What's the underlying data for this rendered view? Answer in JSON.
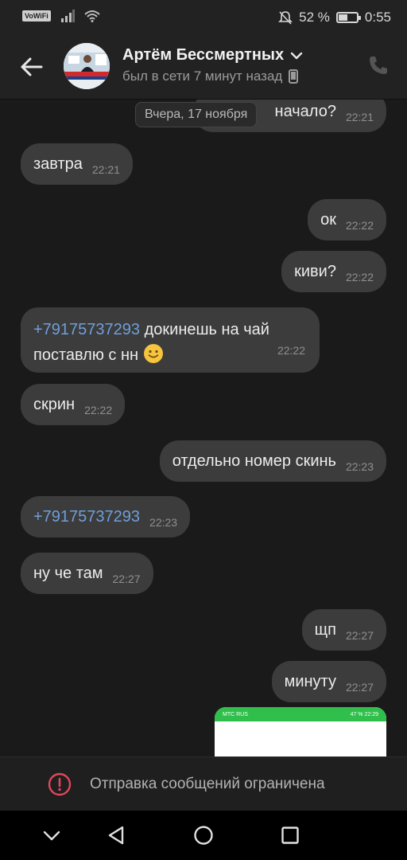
{
  "status_bar": {
    "vowifi": "VoWiFi",
    "battery_text": "52 %",
    "battery_level": 0.52,
    "time": "0:55",
    "icons": [
      "signal-icon",
      "wifi-icon",
      "mute-icon",
      "battery-icon"
    ]
  },
  "header": {
    "contact_name": "Артём Бессмертных",
    "last_seen": "был в сети 7 минут назад",
    "icons": [
      "back-arrow-icon",
      "chevron-down-icon",
      "mobile-phone-icon",
      "phone-call-icon"
    ]
  },
  "chat": {
    "date_separator": "Вчера, 17 ноября",
    "messages": [
      {
        "side": "out",
        "text": "начало?",
        "time": "22:21"
      },
      {
        "side": "in",
        "text": "завтра",
        "time": "22:21"
      },
      {
        "side": "out",
        "text": "ок",
        "time": "22:22"
      },
      {
        "side": "out",
        "text": "киви?",
        "time": "22:22"
      },
      {
        "side": "in",
        "link": "+79175737293",
        "text": " докинешь на чай поставлю с нн",
        "emoji": "slightly-smiling-face",
        "time": "22:22"
      },
      {
        "side": "in",
        "text": "скрин",
        "time": "22:22"
      },
      {
        "side": "out",
        "text": "отдельно номер скинь",
        "time": "22:23"
      },
      {
        "side": "in",
        "link": "+79175737293",
        "time": "22:23"
      },
      {
        "side": "in",
        "text": "ну че там",
        "time": "22:27"
      },
      {
        "side": "out",
        "text": "щп",
        "time": "22:27"
      },
      {
        "side": "out",
        "text": "минуту",
        "time": "22:27"
      }
    ],
    "screenshot_preview": {
      "left": "МТС RUS",
      "right": "47 % 22:29"
    }
  },
  "restricted_bar": {
    "text": "Отправка сообщений ограничена",
    "icon": "alert-circle-icon",
    "accent": "#e0485a"
  },
  "nav_bar": {
    "icons": [
      "collapse-icon",
      "back-icon",
      "home-icon",
      "recents-icon"
    ]
  },
  "colors": {
    "background": "#1a1a1a",
    "bubble": "#3c3c3c",
    "link": "#6f9fd8",
    "header": "#222222"
  }
}
